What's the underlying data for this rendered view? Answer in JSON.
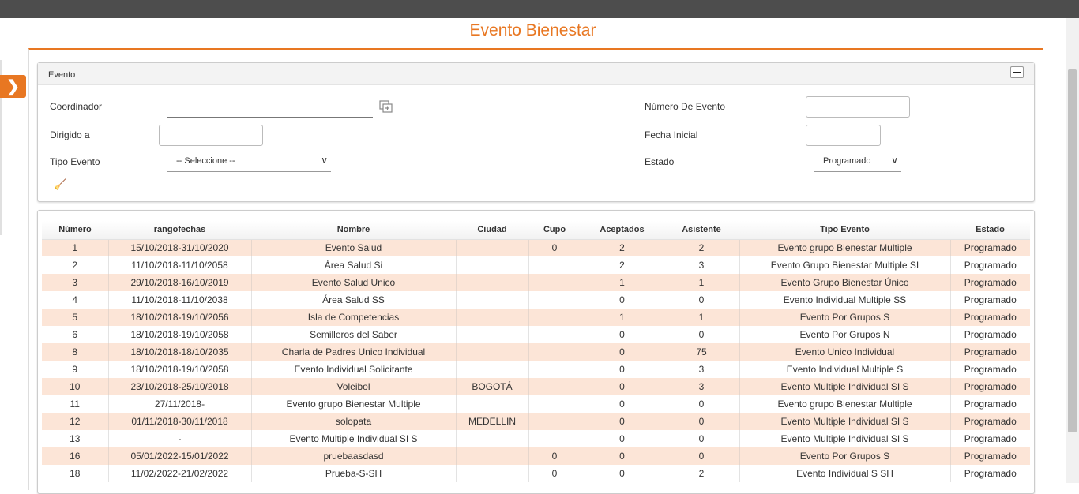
{
  "page": {
    "title": "Evento Bienestar"
  },
  "panel": {
    "title": "Evento",
    "labels": {
      "coordinador": "Coordinador",
      "dirigido": "Dirigido a",
      "tipo_evento": "Tipo Evento",
      "numero_evento": "Número De Evento",
      "fecha_inicial": "Fecha Inicial",
      "estado": "Estado"
    },
    "tipo_evento_value": "-- Seleccione --",
    "estado_value": "Programado"
  },
  "table": {
    "headers": [
      "Número",
      "rangofechas",
      "Nombre",
      "Ciudad",
      "Cupo",
      "Aceptados",
      "Asistente",
      "Tipo Evento",
      "Estado"
    ],
    "rows": [
      [
        "1",
        "15/10/2018-31/10/2020",
        "Evento Salud",
        "",
        "0",
        "2",
        "2",
        "Evento grupo Bienestar Multiple",
        "Programado"
      ],
      [
        "2",
        "11/10/2018-11/10/2058",
        "Área Salud Si",
        "",
        "",
        "2",
        "3",
        "Evento Grupo Bienestar Multiple SI",
        "Programado"
      ],
      [
        "3",
        "29/10/2018-16/10/2019",
        "Evento Salud Unico",
        "",
        "",
        "1",
        "1",
        "Evento Grupo Bienestar Único",
        "Programado"
      ],
      [
        "4",
        "11/10/2018-11/10/2038",
        "Área Salud SS",
        "",
        "",
        "0",
        "0",
        "Evento Individual Multiple SS",
        "Programado"
      ],
      [
        "5",
        "18/10/2018-19/10/2056",
        "Isla de Competencias",
        "",
        "",
        "1",
        "1",
        "Evento Por Grupos S",
        "Programado"
      ],
      [
        "6",
        "18/10/2018-19/10/2058",
        "Semilleros del Saber",
        "",
        "",
        "0",
        "0",
        "Evento Por Grupos N",
        "Programado"
      ],
      [
        "8",
        "18/10/2018-18/10/2035",
        "Charla de Padres Unico Individual",
        "",
        "",
        "0",
        "75",
        "Evento Unico Individual",
        "Programado"
      ],
      [
        "9",
        "18/10/2018-19/10/2058",
        "Evento Individual Solicitante",
        "",
        "",
        "0",
        "3",
        "Evento Individual Multiple S",
        "Programado"
      ],
      [
        "10",
        "23/10/2018-25/10/2018",
        "Voleibol",
        "BOGOTÁ",
        "",
        "0",
        "3",
        "Evento Multiple Individual SI S",
        "Programado"
      ],
      [
        "11",
        "27/11/2018-",
        "Evento grupo Bienestar Multiple",
        "",
        "",
        "0",
        "0",
        "Evento grupo Bienestar Multiple",
        "Programado"
      ],
      [
        "12",
        "01/11/2018-30/11/2018",
        "solopata",
        "MEDELLIN",
        "",
        "0",
        "0",
        "Evento Multiple Individual SI S",
        "Programado"
      ],
      [
        "13",
        "-",
        "Evento Multiple Individual SI S",
        "",
        "",
        "0",
        "0",
        "Evento Multiple Individual SI S",
        "Programado"
      ],
      [
        "16",
        "05/01/2022-15/01/2022",
        "pruebaasdasd",
        "",
        "0",
        "0",
        "0",
        "Evento Por Grupos S",
        "Programado"
      ],
      [
        "18",
        "11/02/2022-21/02/2022",
        "Prueba-S-SH",
        "",
        "0",
        "0",
        "2",
        "Evento Individual S SH",
        "Programado"
      ]
    ]
  }
}
